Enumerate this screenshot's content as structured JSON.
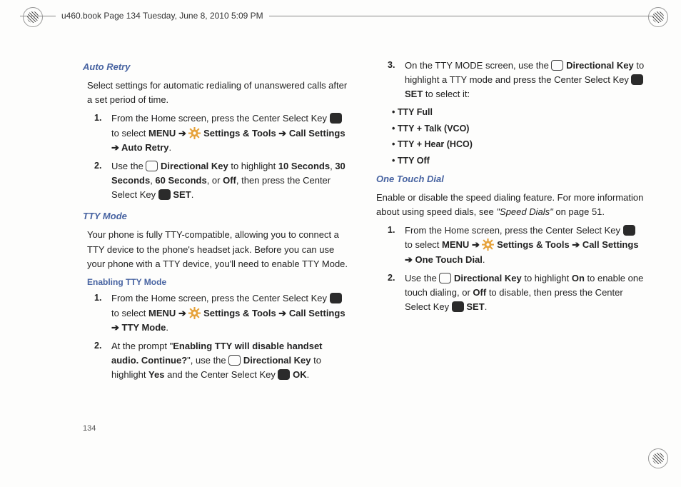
{
  "header": "u460.book  Page 134  Tuesday, June 8, 2010  5:09 PM",
  "pageNumber": "134",
  "labels": {
    "menu": "MENU",
    "arrow": " ➔ ",
    "settingsTools": " Settings & Tools ",
    "callSettings": " Call Settings ",
    "set": " SET",
    "ok": " OK",
    "dirKey": " Directional Key"
  },
  "sec": {
    "autoRetry": {
      "title": "Auto Retry",
      "intro": "Select settings for automatic redialing of unanswered calls after a set period of time.",
      "s1a": "From the Home screen, press the Center Select Key ",
      "s1b": " to select ",
      "s1c": "Auto Retry",
      "s2a": "Use the ",
      "s2b": " to highlight ",
      "s2opts": {
        "a": "10 Seconds",
        "b": "30 Seconds",
        "c": "60 Seconds",
        "d": "Off"
      },
      "s2c": ", then press the Center Select Key ",
      "s2d": "."
    },
    "ttyMode": {
      "title": "TTY Mode",
      "intro": "Your phone is fully TTY-compatible, allowing you to connect a TTY device to the phone's headset jack. Before you can use your phone with a TTY device, you'll need to enable TTY Mode.",
      "sub": "Enabling TTY Mode",
      "s1a": "From the Home screen, press the Center Select Key ",
      "s1b": " to select ",
      "s1c": "TTY Mode",
      "s2a": "At the prompt \"",
      "s2q": "Enabling TTY will disable handset audio. Continue?",
      "s2b": "\", use the ",
      "s2c": " to highlight ",
      "s2yes": "Yes",
      "s2d": " and the Center Select Key ",
      "s2e": "."
    },
    "col2Top": {
      "s3a": "On the TTY MODE screen, use the ",
      "s3b": " to highlight a TTY mode and press the Center Select Key ",
      "s3c": " to select it:",
      "opts": {
        "a": "TTY Full",
        "b": "TTY + Talk (VCO)",
        "c": "TTY + Hear (HCO)",
        "d": "TTY Off"
      }
    },
    "oneTouch": {
      "title": "One Touch Dial",
      "intro1": "Enable or disable the speed dialing feature. For more information about using speed dials, see ",
      "introRef": "\"Speed Dials\"",
      "intro2": " on page 51.",
      "s1a": "From the Home screen, press the Center Select Key ",
      "s1b": " to select ",
      "s1c": "One Touch Dial",
      "s2a": "Use the ",
      "s2b": " to highlight ",
      "s2on": "On",
      "s2c": " to enable one touch dialing, or ",
      "s2off": "Off",
      "s2d": " to disable, then press the Center Select Key ",
      "s2e": "."
    }
  }
}
